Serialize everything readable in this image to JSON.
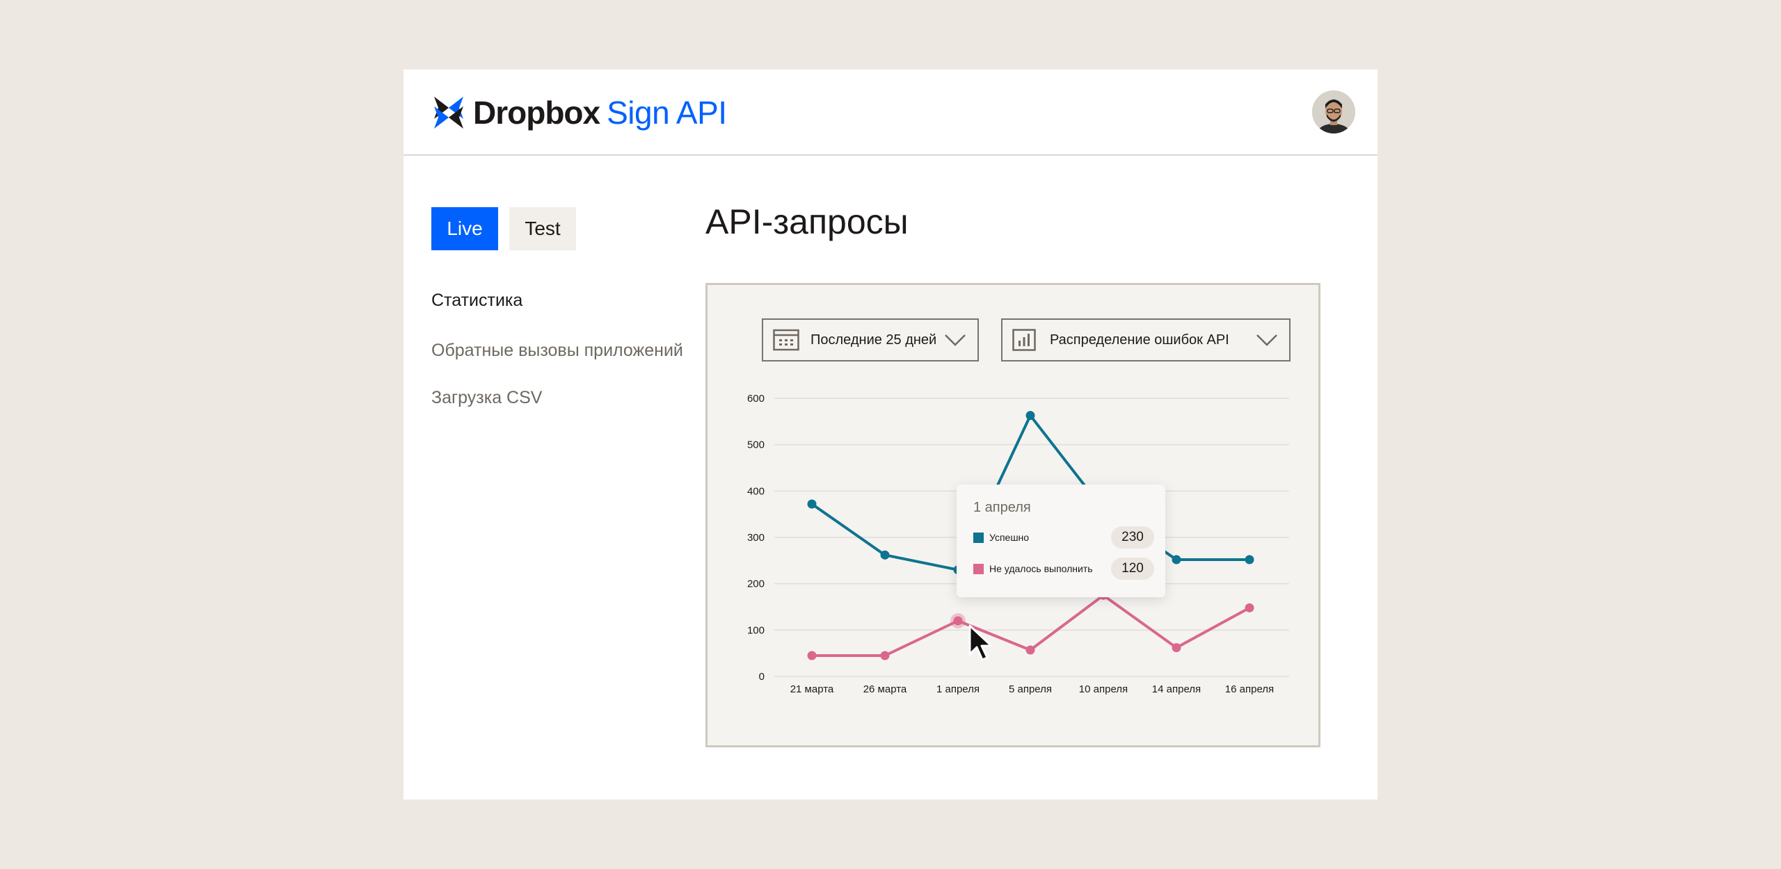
{
  "header": {
    "brand": "Dropbox",
    "product": "Sign API"
  },
  "env_tabs": {
    "live": "Live",
    "test": "Test"
  },
  "nav": [
    {
      "label": "Статистика",
      "active": true
    },
    {
      "label": "Обратные вызовы приложений",
      "active": false
    },
    {
      "label": "Загрузка CSV",
      "active": false
    }
  ],
  "page_title": "API-запросы",
  "filters": {
    "date_range": {
      "label": "Последние 25 дней",
      "icon": "calendar-icon"
    },
    "metric": {
      "label": "Распределение ошибок API",
      "icon": "bar-chart-icon"
    }
  },
  "colors": {
    "accent": "#0061fe",
    "success": "#0e7490",
    "failed": "#d9678e"
  },
  "tooltip": {
    "date": "1 апреля",
    "rows": [
      {
        "label": "Успешно",
        "value": "230"
      },
      {
        "label": "Не удалось выполнить",
        "value": "120"
      }
    ]
  },
  "chart_data": {
    "type": "line",
    "categories": [
      "21 марта",
      "26 марта",
      "1 апреля",
      "5 апреля",
      "10 апреля",
      "14 апреля",
      "16 апреля"
    ],
    "series": [
      {
        "name": "Успешно",
        "values": [
          372,
          262,
          230,
          563,
          360,
          252,
          252
        ]
      },
      {
        "name": "Не удалось выполнить",
        "values": [
          45,
          45,
          120,
          57,
          175,
          62,
          148
        ]
      }
    ],
    "yticks": [
      "0",
      "100",
      "200",
      "300",
      "400",
      "500",
      "600"
    ],
    "ylim": [
      0,
      600
    ],
    "grid": true,
    "highlight_index": 2
  }
}
